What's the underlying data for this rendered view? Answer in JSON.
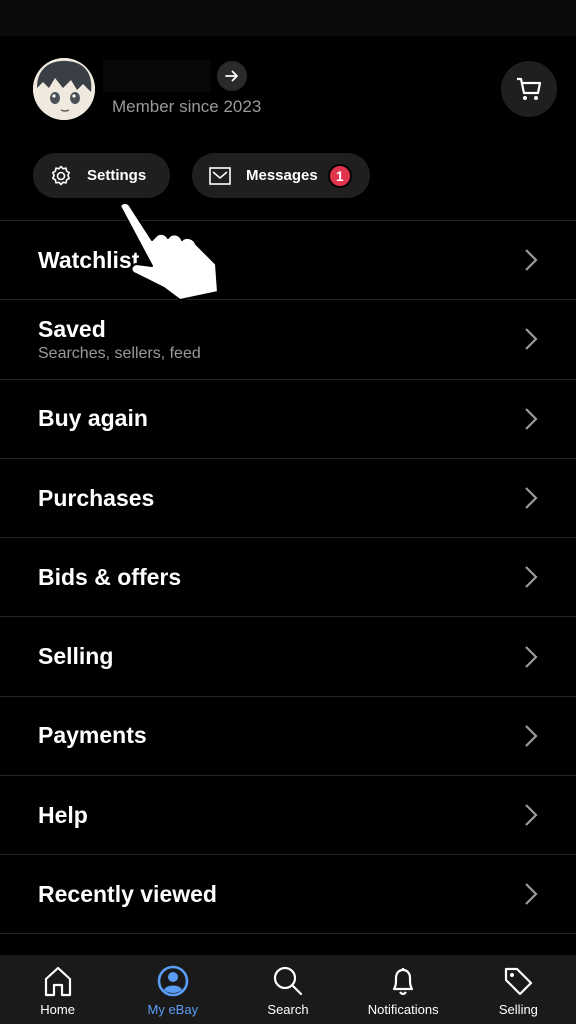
{
  "profile": {
    "member_since": "Member since 2023",
    "avatar": "anime-avatar"
  },
  "header": {
    "cart_icon": "cart-icon",
    "profile_arrow_icon": "arrow-right-icon"
  },
  "chips": {
    "settings_label": "Settings",
    "messages_label": "Messages",
    "messages_badge": "1"
  },
  "menu": {
    "items": [
      {
        "title": "Watchlist",
        "subtitle": ""
      },
      {
        "title": "Saved",
        "subtitle": "Searches, sellers, feed"
      },
      {
        "title": "Buy again",
        "subtitle": ""
      },
      {
        "title": "Purchases",
        "subtitle": ""
      },
      {
        "title": "Bids & offers",
        "subtitle": ""
      },
      {
        "title": "Selling",
        "subtitle": ""
      },
      {
        "title": "Payments",
        "subtitle": ""
      },
      {
        "title": "Help",
        "subtitle": ""
      },
      {
        "title": "Recently viewed",
        "subtitle": ""
      }
    ]
  },
  "tabbar": {
    "tabs": [
      {
        "label": "Home",
        "icon": "home-icon",
        "active": false
      },
      {
        "label": "My eBay",
        "icon": "profile-icon",
        "active": true
      },
      {
        "label": "Search",
        "icon": "search-icon",
        "active": false
      },
      {
        "label": "Notifications",
        "icon": "bell-icon",
        "active": false
      },
      {
        "label": "Selling",
        "icon": "tag-icon",
        "active": false
      }
    ]
  },
  "colors": {
    "accent": "#5b9cf5",
    "badge": "#e0344f",
    "background": "#000000",
    "surface": "#1f1f1f"
  }
}
